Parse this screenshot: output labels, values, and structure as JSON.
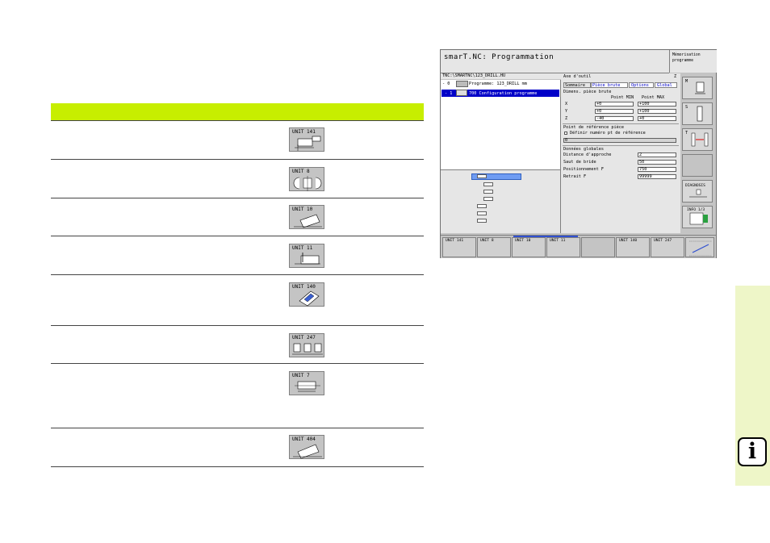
{
  "units": [
    {
      "label": "UNIT 141",
      "icon": "unit-141-icon"
    },
    {
      "label": "UNIT 8",
      "icon": "unit-8-icon"
    },
    {
      "label": "UNIT 10",
      "icon": "unit-10-icon"
    },
    {
      "label": "UNIT 11",
      "icon": "unit-11-icon"
    },
    {
      "label": "UNIT 140",
      "icon": "unit-140-icon"
    },
    {
      "label": "UNIT 247",
      "icon": "unit-247-icon"
    },
    {
      "label": "UNIT 7",
      "icon": "unit-7-icon"
    },
    {
      "label": "UNIT 404",
      "icon": "unit-404-icon"
    }
  ],
  "info_glyph": "i",
  "colors": {
    "header": "#c7ee00",
    "info_band": "#eef6c8",
    "screen_bg": "#c4c4c4",
    "selected": "#0000c8"
  },
  "screen": {
    "title": "smarT.NC: Programmation",
    "mode_line1": "Mémorisation",
    "mode_line2": "programme",
    "path": "TNC:\\SMARTNC\\123_DRILL.HU",
    "tree": {
      "row0_num": "- 0",
      "row0_text": "Programme: 123_DRILL mm",
      "row1_num": "- 1",
      "row1_text": "700 Configuration programme"
    },
    "form": {
      "tool_axis_label": "Axe d'outil",
      "tool_axis_value": "Z",
      "tabs": [
        "Sommaire",
        "Pièce brute",
        "Options",
        "Global"
      ],
      "blank_title": "Dimens. pièce brute",
      "col_min": "Point MIN",
      "col_max": "Point MAX",
      "rows": [
        {
          "axis": "X",
          "min": "+0",
          "max": "+100"
        },
        {
          "axis": "Y",
          "min": "+0",
          "max": "+100"
        },
        {
          "axis": "Z",
          "min": "-40",
          "max": "+0"
        }
      ],
      "ref_title": "Point de référence pièce",
      "ref_checkbox": "Définir numéro pt de référence",
      "ref_value": "0",
      "global_title": "Données globales",
      "globals": [
        {
          "label": "Distance d'approche",
          "value": "2"
        },
        {
          "label": "Saut de bride",
          "value": "50"
        },
        {
          "label": "Positionnement F",
          "value": "750"
        },
        {
          "label": "Retrait F",
          "value": "99999"
        }
      ]
    },
    "side": {
      "m": "M",
      "s": "S",
      "t": "T",
      "diagnosis": "DIAGNOSIS",
      "info": "INFO 1/3"
    },
    "softkeys": [
      "UNIT 141",
      "UNIT 8",
      "UNIT 10",
      "UNIT 11",
      "UNIT 140",
      "UNIT 247"
    ]
  }
}
